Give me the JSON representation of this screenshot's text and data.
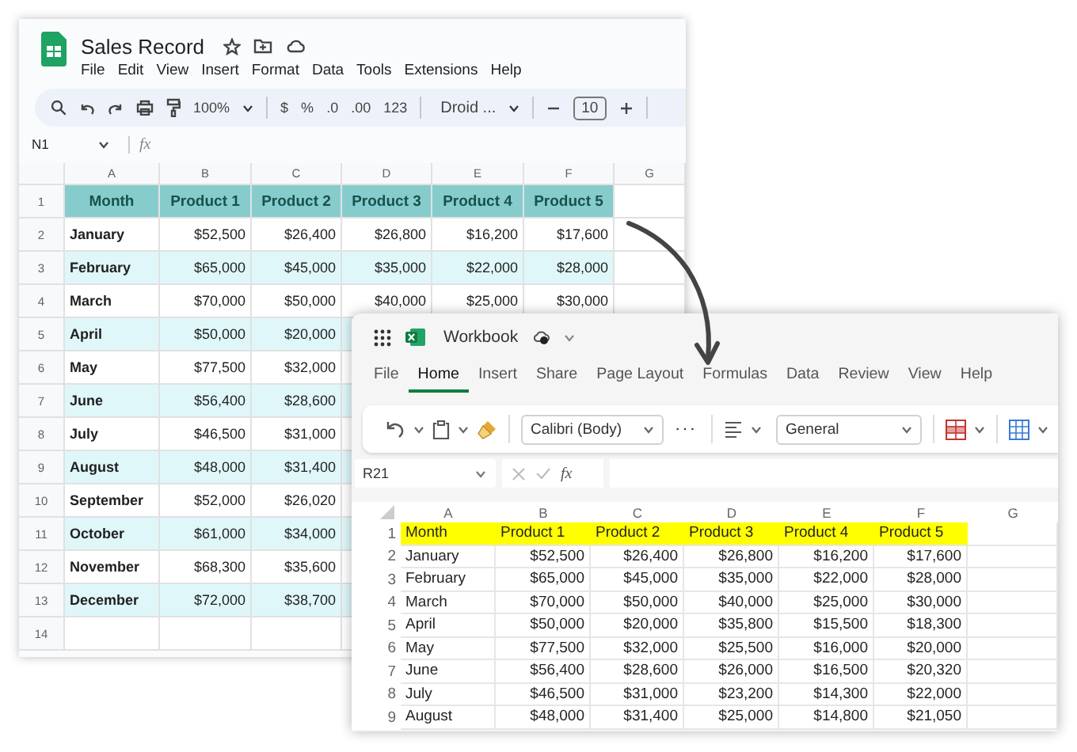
{
  "sheets_window": {
    "title": "Sales Record",
    "menu": [
      "File",
      "Edit",
      "View",
      "Insert",
      "Format",
      "Data",
      "Tools",
      "Extensions",
      "Help"
    ],
    "toolbar": {
      "zoom": "100%",
      "currency": "$",
      "percent": "%",
      "decrease_decimals": ".0",
      "increase_decimals": ".00",
      "number_format": "123",
      "font": "Droid ...",
      "font_size": "10"
    },
    "name_box": "N1",
    "formula_label": "fx",
    "columns": [
      "A",
      "B",
      "C",
      "D",
      "E",
      "F",
      "G"
    ],
    "rows": [
      {
        "number": "1",
        "kind": "header",
        "cells": [
          "Month",
          "Product 1",
          "Product 2",
          "Product 3",
          "Product 4",
          "Product 5"
        ]
      },
      {
        "number": "2",
        "kind": "data",
        "cells": [
          "January",
          "$52,500",
          "$26,400",
          "$26,800",
          "$16,200",
          "$17,600"
        ]
      },
      {
        "number": "3",
        "kind": "data",
        "cells": [
          "February",
          "$65,000",
          "$45,000",
          "$35,000",
          "$22,000",
          "$28,000"
        ]
      },
      {
        "number": "4",
        "kind": "data",
        "cells": [
          "March",
          "$70,000",
          "$50,000",
          "$40,000",
          "$25,000",
          "$30,000"
        ]
      },
      {
        "number": "5",
        "kind": "data",
        "cells": [
          "April",
          "$50,000",
          "$20,000"
        ]
      },
      {
        "number": "6",
        "kind": "data",
        "cells": [
          "May",
          "$77,500",
          "$32,000"
        ]
      },
      {
        "number": "7",
        "kind": "data",
        "cells": [
          "June",
          "$56,400",
          "$28,600"
        ]
      },
      {
        "number": "8",
        "kind": "data",
        "cells": [
          "July",
          "$46,500",
          "$31,000"
        ]
      },
      {
        "number": "9",
        "kind": "data",
        "cells": [
          "August",
          "$48,000",
          "$31,400"
        ]
      },
      {
        "number": "10",
        "kind": "data",
        "cells": [
          "September",
          "$52,000",
          "$26,020"
        ]
      },
      {
        "number": "11",
        "kind": "data",
        "cells": [
          "October",
          "$61,000",
          "$34,000"
        ]
      },
      {
        "number": "12",
        "kind": "data",
        "cells": [
          "November",
          "$68,300",
          "$35,600"
        ]
      },
      {
        "number": "13",
        "kind": "data",
        "cells": [
          "December",
          "$72,000",
          "$38,700"
        ]
      },
      {
        "number": "14",
        "kind": "data",
        "cells": []
      }
    ]
  },
  "excel_window": {
    "title": "Workbook",
    "tabs": [
      {
        "label": "File",
        "selected": false
      },
      {
        "label": "Home",
        "selected": true
      },
      {
        "label": "Insert",
        "selected": false
      },
      {
        "label": "Share",
        "selected": false
      },
      {
        "label": "Page Layout",
        "selected": false
      },
      {
        "label": "Formulas",
        "selected": false
      },
      {
        "label": "Data",
        "selected": false
      },
      {
        "label": "Review",
        "selected": false
      },
      {
        "label": "View",
        "selected": false
      },
      {
        "label": "Help",
        "selected": false
      }
    ],
    "toolbar": {
      "font": "Calibri (Body)",
      "more": "···",
      "number_format": "General"
    },
    "name_box": "R21",
    "formula_label": "fx",
    "columns": [
      "A",
      "B",
      "C",
      "D",
      "E",
      "F",
      "G"
    ],
    "rows": [
      {
        "number": "1",
        "kind": "header",
        "cells": [
          "Month",
          "Product 1",
          "Product 2",
          "Product 3",
          "Product 4",
          "Product 5"
        ]
      },
      {
        "number": "2",
        "kind": "data",
        "cells": [
          "January",
          "$52,500",
          "$26,400",
          "$26,800",
          "$16,200",
          "$17,600"
        ]
      },
      {
        "number": "3",
        "kind": "data",
        "cells": [
          "February",
          "$65,000",
          "$45,000",
          "$35,000",
          "$22,000",
          "$28,000"
        ]
      },
      {
        "number": "4",
        "kind": "data",
        "cells": [
          "March",
          "$70,000",
          "$50,000",
          "$40,000",
          "$25,000",
          "$30,000"
        ]
      },
      {
        "number": "5",
        "kind": "data",
        "cells": [
          "April",
          "$50,000",
          "$20,000",
          "$35,800",
          "$15,500",
          "$18,300"
        ]
      },
      {
        "number": "6",
        "kind": "data",
        "cells": [
          "May",
          "$77,500",
          "$32,000",
          "$25,500",
          "$16,000",
          "$20,000"
        ]
      },
      {
        "number": "7",
        "kind": "data",
        "cells": [
          "June",
          "$56,400",
          "$28,600",
          "$26,000",
          "$16,500",
          "$20,320"
        ]
      },
      {
        "number": "8",
        "kind": "data",
        "cells": [
          "July",
          "$46,500",
          "$31,000",
          "$23,200",
          "$14,300",
          "$22,000"
        ]
      },
      {
        "number": "9",
        "kind": "data",
        "cells": [
          "August",
          "$48,000",
          "$31,400",
          "$25,000",
          "$14,800",
          "$21,050"
        ]
      }
    ]
  }
}
